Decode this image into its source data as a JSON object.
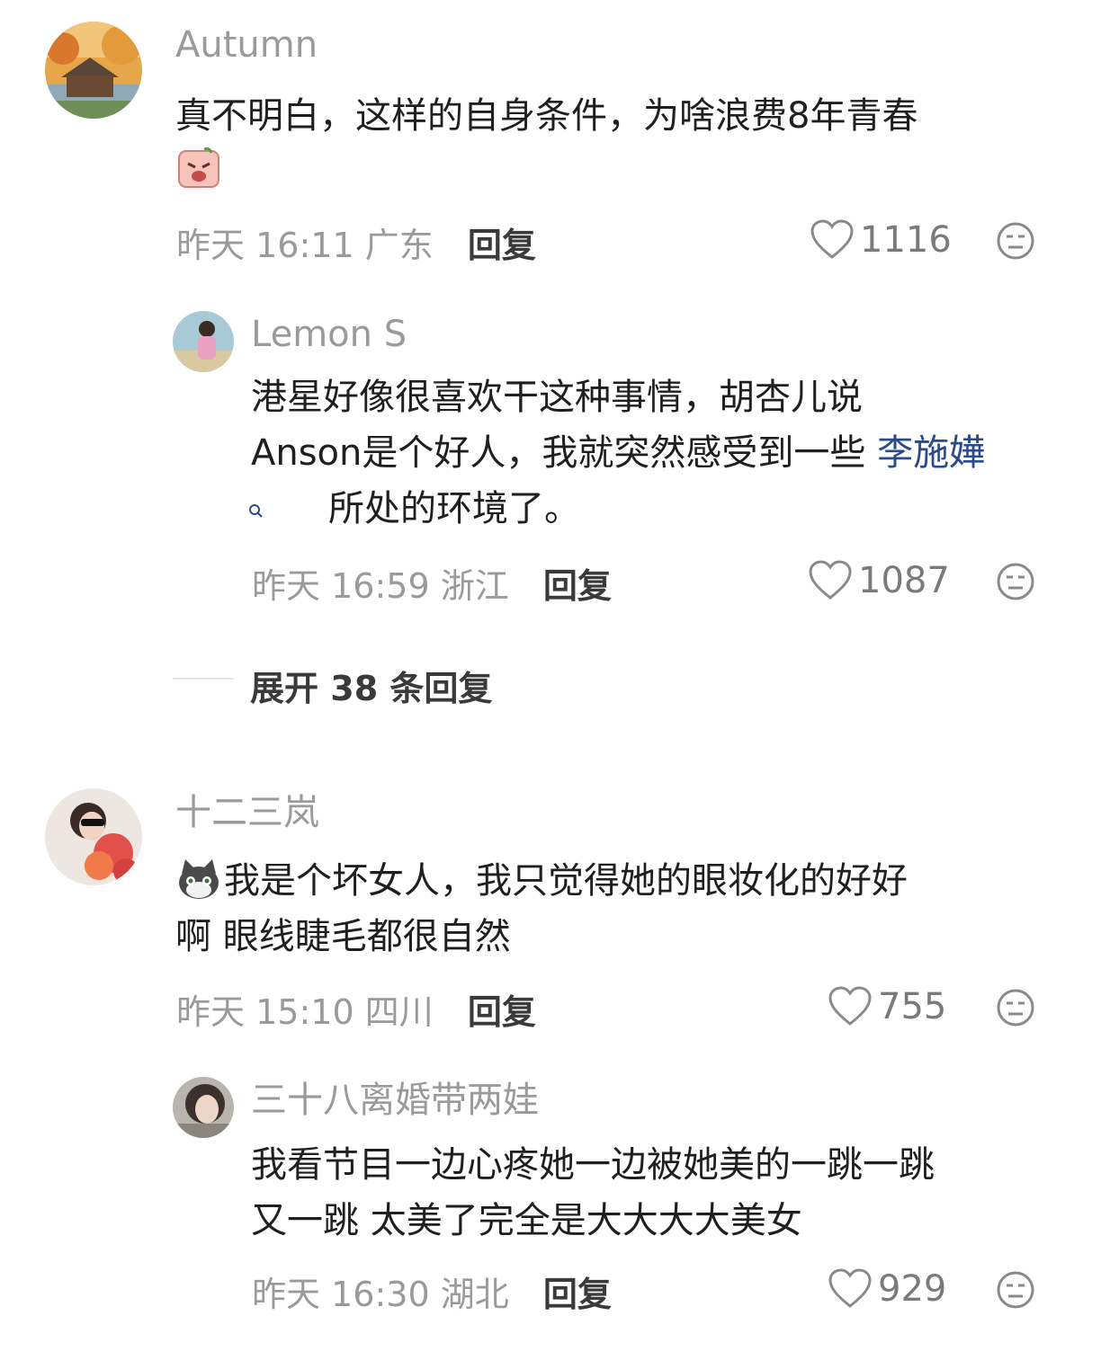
{
  "comments": [
    {
      "author": "Autumn",
      "text": "真不明白，这样的自身条件，为啥浪费8年青春",
      "emoji": "crying-face-sticker",
      "date": "昨天",
      "time": "16:11",
      "location": "广东",
      "reply_label": "回复",
      "likes": "1116",
      "replies": [
        {
          "author": "Lemon S",
          "text_line1": "港星好像很喜欢干这种事情，胡杏儿说",
          "text_line2": "Anson是个好人，我就突然感受到一些",
          "mention": "李施嬅",
          "text_tail": "所处的环境了。",
          "date": "昨天",
          "time": "16:59",
          "location": "浙江",
          "reply_label": "回复",
          "likes": "1087"
        }
      ],
      "expand": {
        "prefix": "展开",
        "count": "38",
        "suffix": "条回复"
      }
    },
    {
      "author": "十二三岚",
      "emoji": "cat-sticker",
      "text_line1": "我是个坏女人，我只觉得她的眼妆化的好好",
      "text_line2": "啊 眼线睫毛都很自然",
      "date": "昨天",
      "time": "15:10",
      "location": "四川",
      "reply_label": "回复",
      "likes": "755",
      "replies": [
        {
          "author": "三十八离婚带两娃",
          "text_line1": "我看节目一边心疼她一边被她美的一跳一跳",
          "text_line2": "又一跳 太美了完全是大大大大美女",
          "date": "昨天",
          "time": "16:30",
          "location": "湖北",
          "reply_label": "回复",
          "likes": "929"
        }
      ]
    }
  ],
  "colors": {
    "meta": "#9a9a9a",
    "text": "#1f1f1f",
    "mention": "#2b4a8b"
  }
}
